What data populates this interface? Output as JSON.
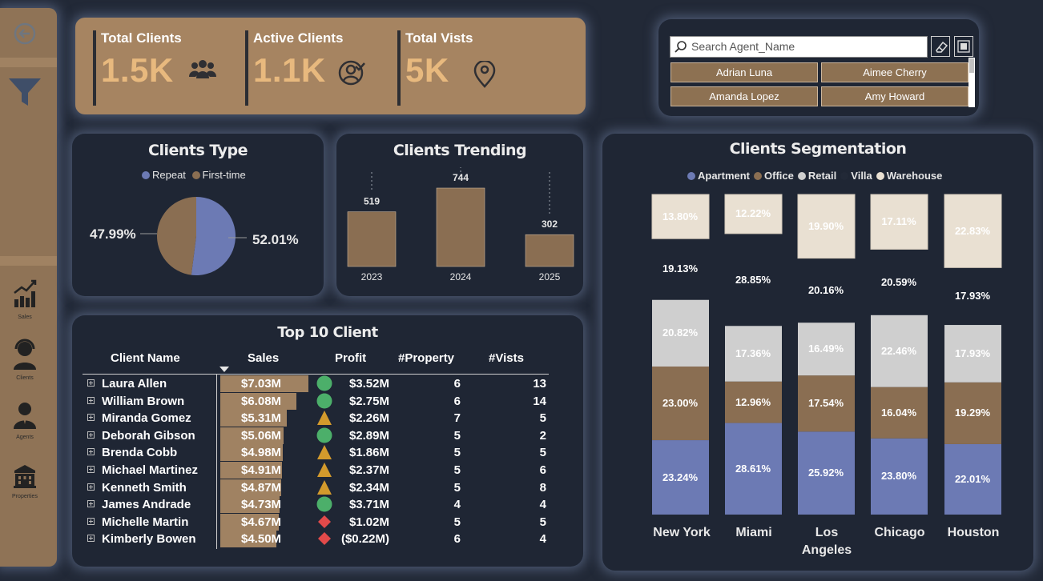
{
  "sidebar": {
    "nav": [
      {
        "label": "Sales"
      },
      {
        "label": "Clients"
      },
      {
        "label": "Agents"
      },
      {
        "label": "Properties"
      }
    ]
  },
  "kpis": [
    {
      "title": "Total Clients",
      "value": "1.5K",
      "icon": "people-icon"
    },
    {
      "title": "Active Clients",
      "value": "1.1K",
      "icon": "user-check-icon"
    },
    {
      "title": "Total Vists",
      "value": "5K",
      "icon": "map-pin-icon"
    }
  ],
  "agent_filter": {
    "placeholder": "Search Agent_Name",
    "agents": [
      "Adrian Luna",
      "Aimee Cherry",
      "Amanda Lopez",
      "Amy Howard"
    ]
  },
  "clients_type": {
    "title": "Clients Type",
    "legend": [
      "Repeat",
      "First-time"
    ],
    "left_label": "47.99%",
    "right_label": "52.01%",
    "colors": {
      "Repeat": "#6c7ab4",
      "First-time": "#8a6e52"
    }
  },
  "clients_trending": {
    "title": "Clients Trending"
  },
  "top_clients": {
    "title": "Top 10 Client",
    "headers": [
      "Client Name",
      "Sales",
      "Profit",
      "#Property",
      "#Vists"
    ],
    "rows": [
      {
        "name": "Laura Allen",
        "sales": "$7.03M",
        "sales_val": 7.03,
        "status": "good",
        "profit": "$3.52M",
        "property": "6",
        "visits": "13"
      },
      {
        "name": "William Brown",
        "sales": "$6.08M",
        "sales_val": 6.08,
        "status": "good",
        "profit": "$2.75M",
        "property": "6",
        "visits": "14"
      },
      {
        "name": "Miranda Gomez",
        "sales": "$5.31M",
        "sales_val": 5.31,
        "status": "warn",
        "profit": "$2.26M",
        "property": "7",
        "visits": "5"
      },
      {
        "name": "Deborah Gibson",
        "sales": "$5.06M",
        "sales_val": 5.06,
        "status": "good",
        "profit": "$2.89M",
        "property": "5",
        "visits": "2"
      },
      {
        "name": "Brenda Cobb",
        "sales": "$4.98M",
        "sales_val": 4.98,
        "status": "warn",
        "profit": "$1.86M",
        "property": "5",
        "visits": "5"
      },
      {
        "name": "Michael Martinez",
        "sales": "$4.91M",
        "sales_val": 4.91,
        "status": "warn",
        "profit": "$2.37M",
        "property": "5",
        "visits": "6"
      },
      {
        "name": "Kenneth Smith",
        "sales": "$4.87M",
        "sales_val": 4.87,
        "status": "warn",
        "profit": "$2.34M",
        "property": "5",
        "visits": "8"
      },
      {
        "name": "James Andrade",
        "sales": "$4.73M",
        "sales_val": 4.73,
        "status": "good",
        "profit": "$3.71M",
        "property": "4",
        "visits": "4"
      },
      {
        "name": "Michelle Martin",
        "sales": "$4.67M",
        "sales_val": 4.67,
        "status": "bad",
        "profit": "$1.02M",
        "property": "5",
        "visits": "5"
      },
      {
        "name": "Kimberly Bowen",
        "sales": "$4.50M",
        "sales_val": 4.5,
        "status": "bad",
        "profit": "($0.22M)",
        "property": "6",
        "visits": "4"
      }
    ]
  },
  "segmentation": {
    "title": "Clients Segmentation",
    "legend": [
      {
        "name": "Apartment",
        "color": "#6c7ab4"
      },
      {
        "name": "Office",
        "color": "#8a6e52"
      },
      {
        "name": "Retail",
        "color": "#cfcfcf"
      },
      {
        "name": "Villa",
        "color": "#222937"
      },
      {
        "name": "Warehouse",
        "color": "#e9e0d2"
      }
    ]
  },
  "chart_data": [
    {
      "type": "pie",
      "title": "Clients Type",
      "categories": [
        "Repeat",
        "First-time"
      ],
      "values": [
        52.01,
        47.99
      ],
      "legend": "top"
    },
    {
      "type": "bar",
      "title": "Clients Trending",
      "categories": [
        "2023",
        "2024",
        "2025"
      ],
      "values": [
        519,
        744,
        302
      ],
      "ylim": [
        0,
        744
      ]
    },
    {
      "type": "bar",
      "title": "Clients Segmentation",
      "categories": [
        "New York",
        "Miami",
        "Los Angeles",
        "Chicago",
        "Houston"
      ],
      "series": [
        {
          "name": "Apartment",
          "values": [
            23.24,
            28.61,
            25.92,
            23.8,
            22.01
          ]
        },
        {
          "name": "Office",
          "values": [
            23.0,
            12.96,
            17.54,
            16.04,
            19.29
          ]
        },
        {
          "name": "Retail",
          "values": [
            20.82,
            17.36,
            16.49,
            22.46,
            17.93
          ]
        },
        {
          "name": "Villa",
          "values": [
            19.13,
            28.85,
            20.16,
            20.59,
            17.93
          ]
        },
        {
          "name": "Warehouse",
          "values": [
            13.8,
            12.22,
            19.9,
            17.11,
            22.83
          ]
        }
      ],
      "data_labels": [
        [
          "23.24%",
          "23.00%",
          "20.82%",
          "19.13%",
          "13.80%"
        ],
        [
          "28.61%",
          "12.96%",
          "17.36%",
          "28.85%",
          "12.22%"
        ],
        [
          "25.92%",
          "17.54%",
          "16.49%",
          "20.16%",
          "19.90%"
        ],
        [
          "23.80%",
          "16.04%",
          "22.46%",
          "20.59%",
          "17.11%"
        ],
        [
          "22.01%",
          "19.29%",
          "17.93%",
          "17.93%",
          "22.83%"
        ]
      ],
      "legend": "top",
      "ylim": [
        0,
        100
      ]
    }
  ]
}
